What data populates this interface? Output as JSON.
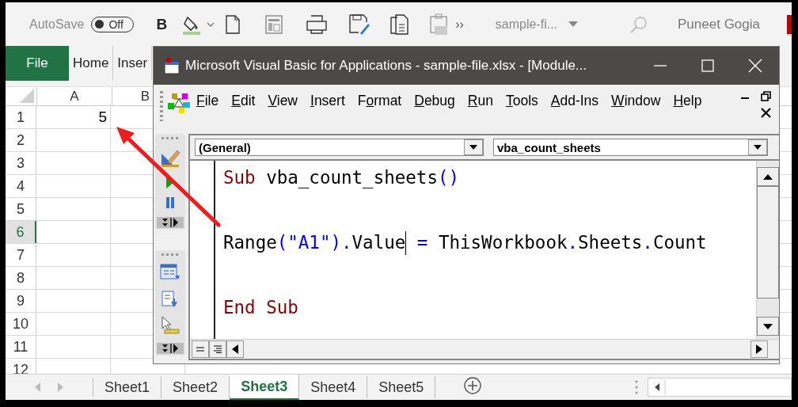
{
  "top_bar": {
    "autosave": {
      "label": "AutoSave",
      "state": "Off",
      "on": false
    },
    "bold": "B",
    "overflow": "››",
    "file_name": "sample-fi...",
    "user": "Puneet Gogia"
  },
  "ribbon_tabs": [
    {
      "label": "File",
      "kind": "file"
    },
    {
      "label": "Home",
      "kind": "tab"
    },
    {
      "label": "Inser",
      "kind": "tab"
    }
  ],
  "sheet": {
    "columns": [
      "A",
      "B"
    ],
    "rows": [
      {
        "label": "1",
        "selected": false,
        "value": "5"
      },
      {
        "label": "2",
        "selected": false
      },
      {
        "label": "3",
        "selected": false
      },
      {
        "label": "4",
        "selected": false
      },
      {
        "label": "5",
        "selected": false
      },
      {
        "label": "6",
        "selected": true
      },
      {
        "label": "7",
        "selected": false
      },
      {
        "label": "8",
        "selected": false
      },
      {
        "label": "9",
        "selected": false
      },
      {
        "label": "10",
        "selected": false
      },
      {
        "label": "11",
        "selected": false
      },
      {
        "label": "12",
        "selected": false
      }
    ]
  },
  "sheet_tabs": [
    {
      "label": "Sheet1",
      "selected": false
    },
    {
      "label": "Sheet2",
      "selected": false
    },
    {
      "label": "Sheet3",
      "selected": true
    },
    {
      "label": "Sheet4",
      "selected": false
    },
    {
      "label": "Sheet5",
      "selected": false
    }
  ],
  "vba_window": {
    "title": "Microsoft Visual Basic for Applications - sample-file.xlsx - [Module...",
    "menus": [
      {
        "key": "F",
        "after": "ile"
      },
      {
        "key": "E",
        "after": "dit"
      },
      {
        "key": "V",
        "after": "iew"
      },
      {
        "key": "I",
        "after": "nsert"
      },
      {
        "before": "F",
        "key": "o",
        "after": "rmat"
      },
      {
        "key": "D",
        "after": "ebug"
      },
      {
        "key": "R",
        "after": "un"
      },
      {
        "key": "T",
        "after": "ools"
      },
      {
        "key": "A",
        "after": "dd-Ins"
      },
      {
        "key": "W",
        "after": "indow"
      },
      {
        "key": "H",
        "after": "elp"
      }
    ],
    "object_combo": "(General)",
    "procedure_combo": "vba_count_sheets",
    "code_lines": [
      [
        {
          "text": "Sub",
          "kind": "keyword"
        },
        {
          "text": " vba_count_sheets",
          "kind": "plain"
        },
        {
          "text": "()",
          "kind": "punct"
        }
      ],
      [
        {
          "text": "Range",
          "kind": "plain"
        },
        {
          "text": "(\"A1\").",
          "kind": "punct"
        },
        {
          "text": "Value",
          "kind": "plain"
        },
        {
          "kind": "cursor"
        },
        {
          "text": " = ",
          "kind": "punct"
        },
        {
          "text": "ThisWorkbook",
          "kind": "plain"
        },
        {
          "text": ".",
          "kind": "punct"
        },
        {
          "text": "Sheets",
          "kind": "plain"
        },
        {
          "text": ".",
          "kind": "punct"
        },
        {
          "text": "Count",
          "kind": "plain"
        }
      ],
      [
        {
          "text": "End Sub",
          "kind": "keyword"
        }
      ]
    ]
  }
}
